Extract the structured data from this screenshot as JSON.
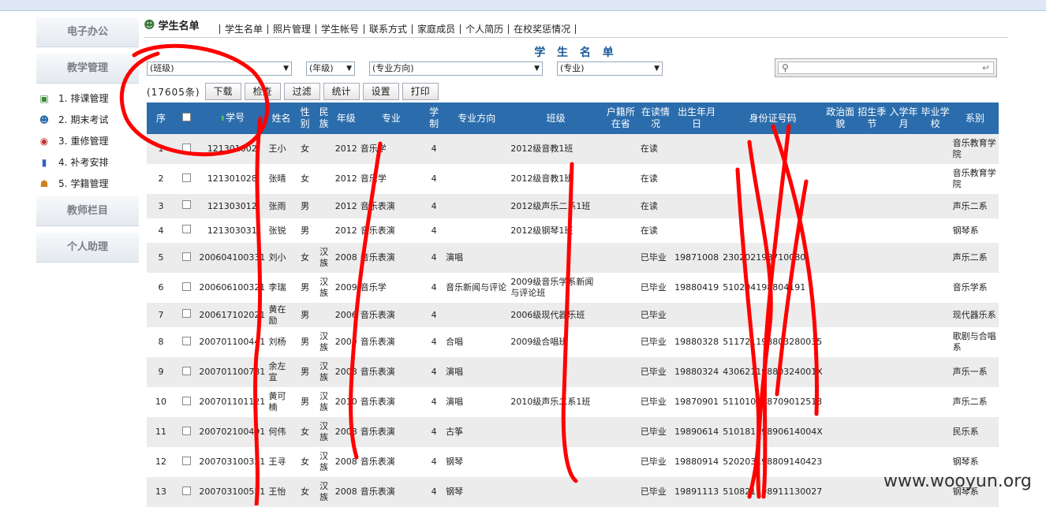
{
  "sidebar": {
    "sections": [
      {
        "label": "电子办公"
      },
      {
        "label": "教学管理"
      }
    ],
    "items": [
      {
        "num": "1.",
        "label": "排课管理",
        "icon": "calendar-icon"
      },
      {
        "num": "2.",
        "label": "期末考试",
        "icon": "users-icon"
      },
      {
        "num": "3.",
        "label": "重修管理",
        "icon": "refresh-icon"
      },
      {
        "num": "4.",
        "label": "补考安排",
        "icon": "chart-icon"
      },
      {
        "num": "5.",
        "label": "学籍管理",
        "icon": "student-icon"
      }
    ],
    "bottom_sections": [
      {
        "label": "教师栏目"
      },
      {
        "label": "个人助理"
      }
    ]
  },
  "tabbar": {
    "current": "学生名单",
    "tabs": [
      "学生名单",
      "照片管理",
      "学生帐号",
      "联系方式",
      "家庭成员",
      "个人简历",
      "在校奖惩情况"
    ]
  },
  "page_title": "学 生 名 单",
  "filters": {
    "class": "(班级)",
    "grade": "(年级)",
    "direction": "(专业方向)",
    "major": "(专业)"
  },
  "toolbar": {
    "count": "(17605条)",
    "buttons": [
      "下载",
      "检查",
      "过滤",
      "统计",
      "设置",
      "打印"
    ]
  },
  "table": {
    "headers": [
      "序",
      "",
      "学号",
      "姓名",
      "性别",
      "民族",
      "年级",
      "专业",
      "学制",
      "专业方向",
      "班级",
      "户籍所在省",
      "在读情况",
      "出生年月日",
      "身份证号码",
      "政治面貌",
      "招生季节",
      "入学年月",
      "毕业学校",
      "系别"
    ],
    "rows": [
      {
        "seq": "1",
        "id": "121301002",
        "name": "王小",
        "sex": "女",
        "nation": "",
        "grade": "2012",
        "major": "音乐学",
        "years": "4",
        "direction": "",
        "class": "2012级音教1班",
        "status": "在读",
        "birth": "",
        "idcard": "",
        "dept": "音乐教育学院"
      },
      {
        "seq": "2",
        "id": "121301028",
        "name": "张晴",
        "sex": "女",
        "nation": "",
        "grade": "2012",
        "major": "音乐学",
        "years": "4",
        "direction": "",
        "class": "2012级音教1班",
        "status": "在读",
        "birth": "",
        "idcard": "",
        "dept": "音乐教育学院"
      },
      {
        "seq": "3",
        "id": "121303012",
        "name": "张雨",
        "sex": "男",
        "nation": "",
        "grade": "2012",
        "major": "音乐表演",
        "years": "4",
        "direction": "",
        "class": "2012级声乐二系1班",
        "status": "在读",
        "birth": "",
        "idcard": "",
        "dept": "声乐二系"
      },
      {
        "seq": "4",
        "id": "121303031",
        "name": "张锐",
        "sex": "男",
        "nation": "",
        "grade": "2012",
        "major": "音乐表演",
        "years": "4",
        "direction": "",
        "class": "2012级钢琴1班",
        "status": "在读",
        "birth": "",
        "idcard": "",
        "dept": "钢琴系"
      },
      {
        "seq": "5",
        "id": "200604100331",
        "name": "刘小",
        "sex": "女",
        "nation": "汉族",
        "grade": "2008",
        "major": "音乐表演",
        "years": "4",
        "direction": "演唱",
        "class": "",
        "status": "已毕业",
        "birth": "19871008",
        "idcard": "230202198710080",
        "dept": "声乐二系"
      },
      {
        "seq": "6",
        "id": "200606100321",
        "name": "李瑞",
        "sex": "男",
        "nation": "汉族",
        "grade": "2009",
        "major": "音乐学",
        "years": "4",
        "direction": "音乐新闻与评论",
        "class": "2009级音乐学系新闻与评论班",
        "status": "已毕业",
        "birth": "19880419",
        "idcard": "510204198804191",
        "dept": "音乐学系"
      },
      {
        "seq": "7",
        "id": "200617102021",
        "name": "黄在励",
        "sex": "男",
        "nation": "",
        "grade": "2006",
        "major": "音乐表演",
        "years": "4",
        "direction": "",
        "class": "2006级现代器乐班",
        "status": "已毕业",
        "birth": "",
        "idcard": "",
        "dept": "现代器乐系"
      },
      {
        "seq": "8",
        "id": "200701100441",
        "name": "刘杨",
        "sex": "男",
        "nation": "汉族",
        "grade": "2009",
        "major": "音乐表演",
        "years": "4",
        "direction": "合唱",
        "class": "2009级合唱班",
        "status": "已毕业",
        "birth": "19880328",
        "idcard": "511721198803280035",
        "dept": "歌剧与合唱系"
      },
      {
        "seq": "9",
        "id": "200701100781",
        "name": "余左宣",
        "sex": "男",
        "nation": "汉族",
        "grade": "2008",
        "major": "音乐表演",
        "years": "4",
        "direction": "演唱",
        "class": "",
        "status": "已毕业",
        "birth": "19880324",
        "idcard": "43062119880324001X",
        "dept": "声乐一系"
      },
      {
        "seq": "10",
        "id": "200701101121",
        "name": "黄可楠",
        "sex": "男",
        "nation": "汉族",
        "grade": "2010",
        "major": "音乐表演",
        "years": "4",
        "direction": "演唱",
        "class": "2010级声乐二系1班",
        "status": "已毕业",
        "birth": "19870901",
        "idcard": "511010198709012513",
        "dept": "声乐二系"
      },
      {
        "seq": "11",
        "id": "200702100491",
        "name": "何伟",
        "sex": "女",
        "nation": "汉族",
        "grade": "2008",
        "major": "音乐表演",
        "years": "4",
        "direction": "古筝",
        "class": "",
        "status": "已毕业",
        "birth": "19890614",
        "idcard": "51018119890614004X",
        "dept": "民乐系"
      },
      {
        "seq": "12",
        "id": "200703100321",
        "name": "王寻",
        "sex": "女",
        "nation": "汉族",
        "grade": "2008",
        "major": "音乐表演",
        "years": "4",
        "direction": "钢琴",
        "class": "",
        "status": "已毕业",
        "birth": "19880914",
        "idcard": "520203198809140423",
        "dept": "钢琴系"
      },
      {
        "seq": "13",
        "id": "200703100551",
        "name": "王怡",
        "sex": "女",
        "nation": "汉族",
        "grade": "2008",
        "major": "音乐表演",
        "years": "4",
        "direction": "钢琴",
        "class": "",
        "status": "已毕业",
        "birth": "19891113",
        "idcard": "510821198911130027",
        "dept": "钢琴系"
      }
    ]
  },
  "watermark": "www.wooyun.org",
  "colors": {
    "header_bg": "#2b6cac",
    "title": "#1a5a9a",
    "scribble": "#ff0000"
  }
}
